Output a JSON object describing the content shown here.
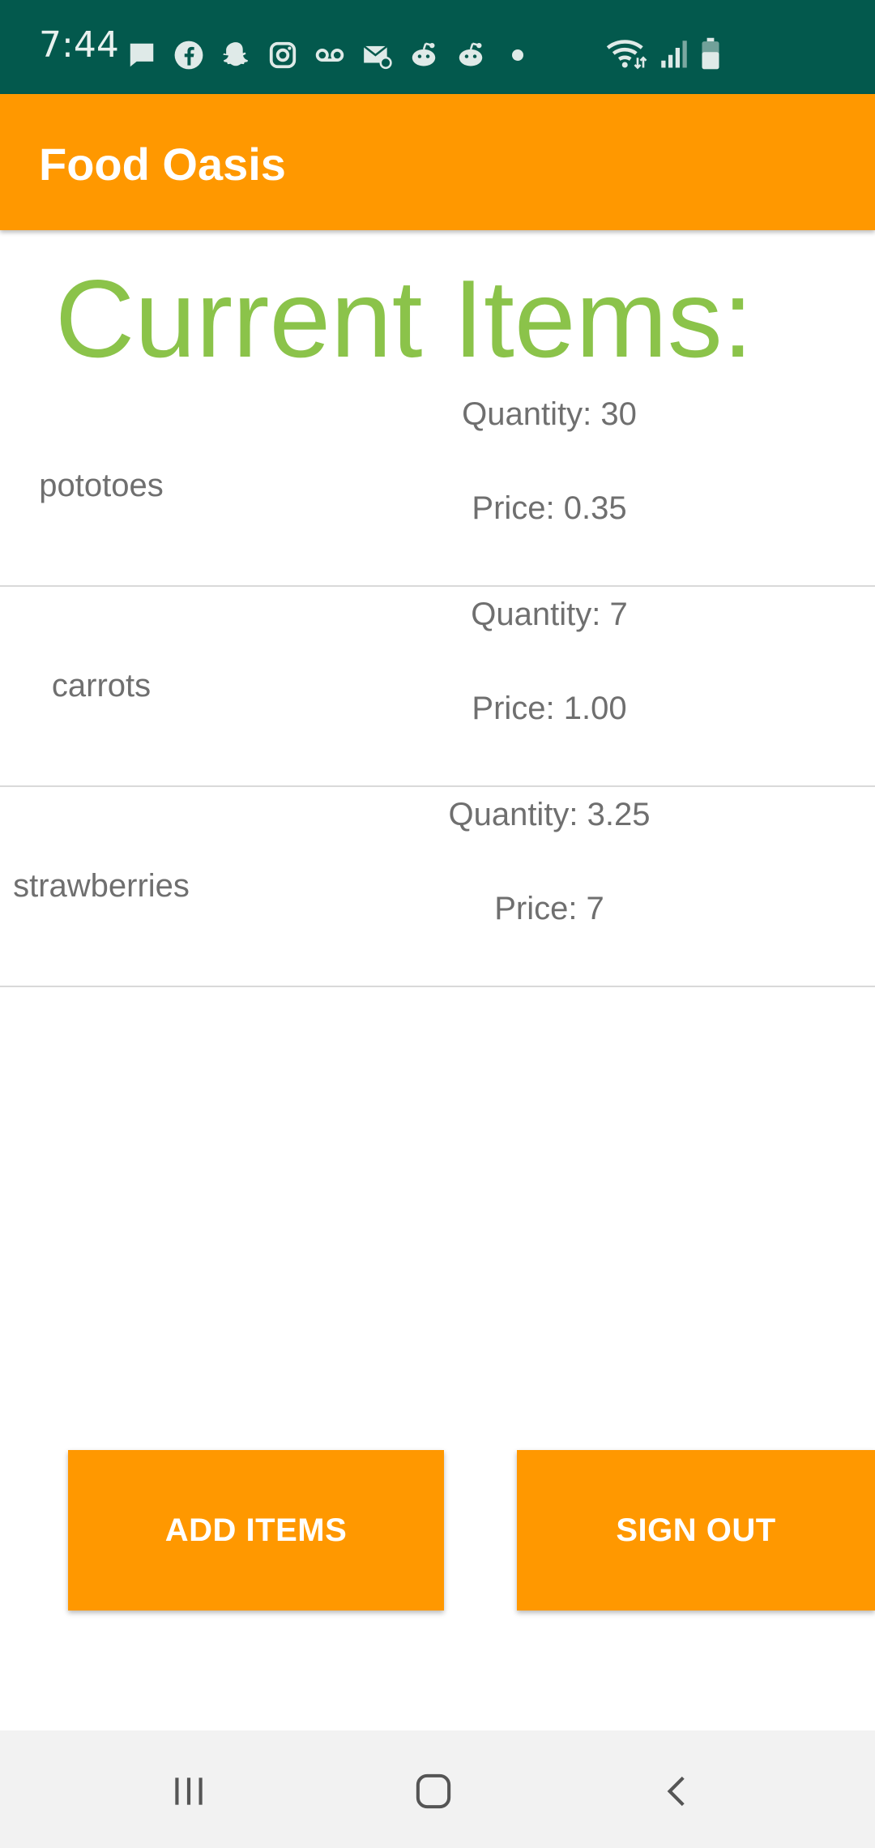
{
  "status_bar": {
    "time": "7:44",
    "left_icons": [
      "message-icon",
      "facebook-icon",
      "snapchat-icon",
      "instagram-icon",
      "voicemail-icon",
      "mail-icon",
      "reddit-icon",
      "reddit-icon",
      "dot-icon"
    ],
    "right_icons": [
      "wifi-icon",
      "signal-icon",
      "battery-icon"
    ],
    "background": "#03594d"
  },
  "app_bar": {
    "title": "Food Oasis",
    "background": "#ff9800"
  },
  "main": {
    "heading": "Current Items:",
    "heading_color": "#8bc34a",
    "items": [
      {
        "name": "pototoes",
        "quantity": "Quantity: 30",
        "price": "Price: 0.35"
      },
      {
        "name": "carrots",
        "quantity": "Quantity: 7",
        "price": "Price: 1.00"
      },
      {
        "name": "strawberries",
        "quantity": "Quantity: 3.25",
        "price": "Price: 7"
      }
    ]
  },
  "actions": {
    "add_items_label": "ADD ITEMS",
    "sign_out_label": "SIGN OUT",
    "button_color": "#ff9800"
  },
  "nav_bar": {
    "buttons": [
      "recent-apps-icon",
      "home-icon",
      "back-icon"
    ]
  }
}
